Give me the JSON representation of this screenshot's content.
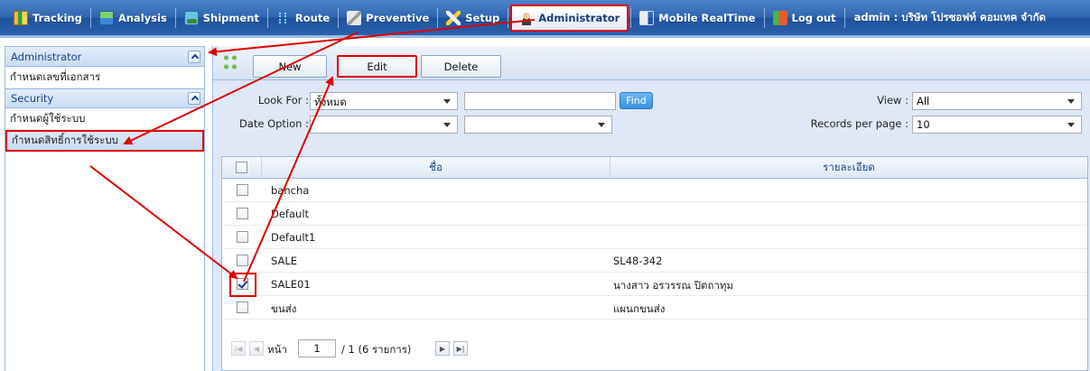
{
  "nav": {
    "items": [
      {
        "label": "Tracking",
        "icon": "tracking-icon"
      },
      {
        "label": "Analysis",
        "icon": "analysis-icon"
      },
      {
        "label": "Shipment",
        "icon": "truck-icon"
      },
      {
        "label": "Route",
        "icon": "route-icon"
      },
      {
        "label": "Preventive",
        "icon": "wrench-icon"
      },
      {
        "label": "Setup",
        "icon": "tools-icon"
      },
      {
        "label": "Administrator",
        "icon": "user-icon",
        "active": true
      },
      {
        "label": "Mobile RealTime",
        "icon": "mobile-icon"
      },
      {
        "label": "Log out",
        "icon": "logout-icon"
      }
    ],
    "user": "admin : บริษัท โปรซอฟท์ คอมเทค จำกัด"
  },
  "sidebar": {
    "sections": [
      {
        "title": "Administrator",
        "items": [
          "กำหนดเลขที่เอกสาร"
        ]
      },
      {
        "title": "Security",
        "items": [
          "กำหนดผู้ใช้ระบบ",
          "กำหนดสิทธิ์การใช้ระบบ"
        ]
      }
    ],
    "selected": "กำหนดสิทธิ์การใช้ระบบ"
  },
  "toolbar": {
    "new_label": "New",
    "edit_label": "Edit",
    "delete_label": "Delete"
  },
  "filter": {
    "look_for_label": "Look For :",
    "look_for_value": "ทั้งหมด",
    "search_value": "",
    "find_label": "Find",
    "date_option_label": "Date Option :",
    "date_option_value": "",
    "date_option2_value": "",
    "view_label": "View :",
    "view_value": "All",
    "records_label": "Records per page :",
    "records_value": "10"
  },
  "grid": {
    "columns": [
      "ชื่อ",
      "รายละเอียด"
    ],
    "rows": [
      {
        "name": "bancha",
        "detail": "",
        "checked": false
      },
      {
        "name": "Default",
        "detail": "",
        "checked": false
      },
      {
        "name": "Default1",
        "detail": "",
        "checked": false
      },
      {
        "name": "SALE",
        "detail": "SL48-342",
        "checked": false
      },
      {
        "name": "SALE01",
        "detail": "นางสาว อรวรรณ ปิตถาทุม",
        "checked": true
      },
      {
        "name": "ขนส่ง",
        "detail": "แผนกขนส่ง",
        "checked": false
      }
    ]
  },
  "pager": {
    "page_label": "หน้า",
    "page_value": "1",
    "total_text": "/ 1 (6 รายการ)"
  },
  "colors": {
    "topbar": "#2f66b0",
    "highlight": "#e00000",
    "panel_border": "#99bbe8",
    "panel_bg": "#dfe8f6"
  }
}
